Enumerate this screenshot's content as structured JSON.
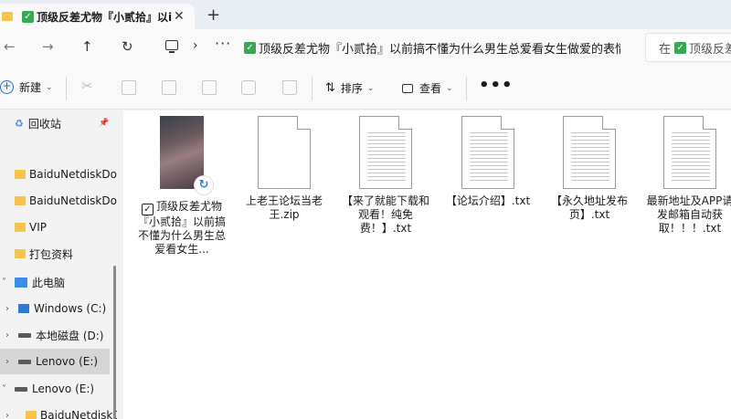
{
  "tab": {
    "title": "顶级反差尤物『小贰拾』以i",
    "close": "✕",
    "new_tab": "+"
  },
  "nav": {
    "back": "←",
    "forward": "→",
    "up": "↑",
    "refresh": "↻",
    "sep": "›",
    "more": "···"
  },
  "breadcrumb": {
    "path": "顶级反差尤物『小贰拾』以前搞不懂为什么男生总爱看女生做爱的表情"
  },
  "search": {
    "prefix": "在",
    "text": "顶级反差尤"
  },
  "command": {
    "new_label": "新建",
    "sort_label": "排序",
    "view_label": "查看",
    "more": "•••"
  },
  "sidebar": {
    "quick": [
      {
        "label": "回收站",
        "type": "recycle"
      },
      {
        "label": "BaiduNetdiskDownload",
        "type": "folder"
      },
      {
        "label": "BaiduNetdiskDownload",
        "type": "folder"
      },
      {
        "label": "VIP",
        "type": "folder"
      },
      {
        "label": "打包资料",
        "type": "folder"
      }
    ],
    "this_pc": "此电脑",
    "drives": [
      {
        "label": "Windows (C:)"
      },
      {
        "label": "本地磁盘 (D:)"
      },
      {
        "label": "Lenovo (E:)"
      }
    ],
    "lenovo": "Lenovo (E:)",
    "bottom_folder": "BaiduNetdiskDownload"
  },
  "files": [
    {
      "name": "顶级反差尤物『小贰拾』以前搞不懂为什么男生总爱看女生...",
      "kind": "video"
    },
    {
      "name": "上老王论坛当老王.zip",
      "kind": "zip"
    },
    {
      "name": "【来了就能下载和观看！纯免费！】.txt",
      "kind": "txt"
    },
    {
      "name": "【论坛介绍】.txt",
      "kind": "txt"
    },
    {
      "name": "【永久地址发布页】.txt",
      "kind": "txt"
    },
    {
      "name": "最新地址及APP请发邮箱自动获取！！！.txt",
      "kind": "txt"
    }
  ]
}
